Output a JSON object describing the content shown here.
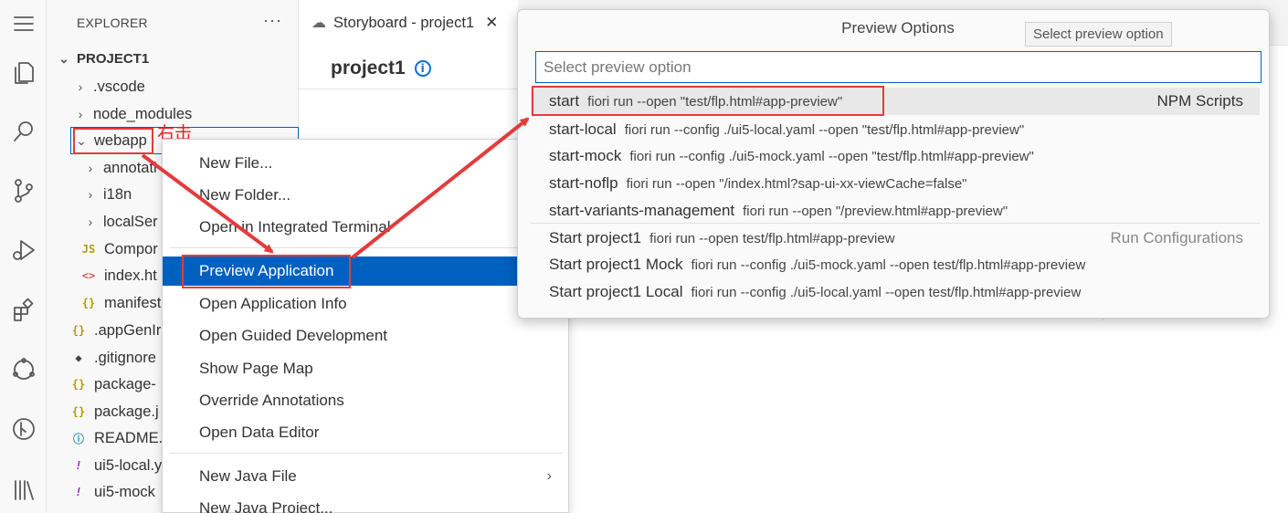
{
  "explorer": {
    "title": "EXPLORER",
    "more": "···",
    "root": "PROJECT1",
    "items": [
      {
        "label": ".vscode",
        "chevron": "›",
        "icon": ""
      },
      {
        "label": "node_modules",
        "chevron": "›",
        "icon": ""
      },
      {
        "label": "webapp",
        "chevron": "⌄",
        "icon": ""
      },
      {
        "label": "annotati",
        "chevron": "›",
        "icon": ""
      },
      {
        "label": "i18n",
        "chevron": "›",
        "icon": ""
      },
      {
        "label": "localSer",
        "chevron": "›",
        "icon": ""
      },
      {
        "label": "Compor",
        "chevron": "",
        "icon": "JS"
      },
      {
        "label": "index.ht",
        "chevron": "",
        "icon": "<>"
      },
      {
        "label": "manifest",
        "chevron": "",
        "icon": "{}"
      },
      {
        "label": ".appGenIr",
        "chevron": "",
        "icon": "{}"
      },
      {
        "label": ".gitignore",
        "chevron": "",
        "icon": "◆"
      },
      {
        "label": "package-",
        "chevron": "",
        "icon": "{}"
      },
      {
        "label": "package.j",
        "chevron": "",
        "icon": "{}"
      },
      {
        "label": "README.",
        "chevron": "",
        "icon": "ⓘ"
      },
      {
        "label": "ui5-local.y",
        "chevron": "",
        "icon": "!"
      },
      {
        "label": "ui5-mock",
        "chevron": "",
        "icon": "!"
      }
    ],
    "annotation": "右击"
  },
  "editor": {
    "tab_label": "Storyboard - project1",
    "tab_close": "✕",
    "project_title": "project1",
    "info_icon": "i"
  },
  "context_menu": {
    "items": [
      {
        "label": "New File..."
      },
      {
        "label": "New Folder..."
      },
      {
        "label": "Open in Integrated Terminal"
      },
      {
        "label": "Preview Application"
      },
      {
        "label": "Open Application Info"
      },
      {
        "label": "Open Guided Development"
      },
      {
        "label": "Show Page Map"
      },
      {
        "label": "Override Annotations"
      },
      {
        "label": "Open Data Editor"
      },
      {
        "label": "New Java File"
      },
      {
        "label": "New Java Project..."
      }
    ],
    "submenu_chevron": "›"
  },
  "quick_pick": {
    "title": "Preview Options",
    "tooltip": "Select preview option",
    "placeholder": "Select preview option",
    "items": [
      {
        "label": "start",
        "description": "fiori run --open \"test/flp.html#app-preview\"",
        "group": "NPM Scripts"
      },
      {
        "label": "start-local",
        "description": "fiori run --config ./ui5-local.yaml --open \"test/flp.html#app-preview\"",
        "group": ""
      },
      {
        "label": "start-mock",
        "description": "fiori run --config ./ui5-mock.yaml --open \"test/flp.html#app-preview\"",
        "group": ""
      },
      {
        "label": "start-noflp",
        "description": "fiori run --open \"/index.html?sap-ui-xx-viewCache=false\"",
        "group": ""
      },
      {
        "label": "start-variants-management",
        "description": "fiori run --open \"/preview.html#app-preview\"",
        "group": ""
      },
      {
        "label": "Start project1",
        "description": "fiori run --open test/flp.html#app-preview",
        "group": "Run Configurations"
      },
      {
        "label": "Start project1 Mock",
        "description": "fiori run --config ./ui5-mock.yaml --open test/flp.html#app-preview",
        "group": ""
      },
      {
        "label": "Start project1 Local",
        "description": "fiori run --config ./ui5-local.yaml --open test/flp.html#app-preview",
        "group": ""
      }
    ]
  },
  "colors": {
    "accent": "#0060c0",
    "highlight_red": "#e23c3c",
    "annotation_red": "#e02020"
  }
}
